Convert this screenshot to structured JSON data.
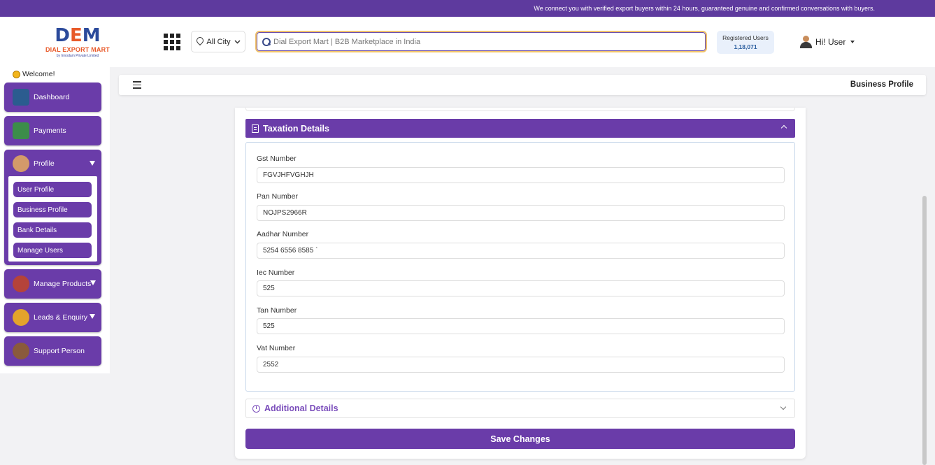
{
  "topbar": {
    "message": "We connect you with verified export buyers within 24 hours, guaranteed genuine and confirmed conversations with buyers."
  },
  "header": {
    "logo_text": "DIAL EXPORT MART",
    "logo_sub": "by Innodam Private Limited",
    "city": "All City",
    "search_placeholder": "Dial Export Mart | B2B Marketplace in India",
    "registered_label": "Registered Users",
    "registered_count": "1,18,071",
    "user_label": "Hi! User"
  },
  "sidebar": {
    "welcome": "Welcome!",
    "items": [
      {
        "label": "Dashboard"
      },
      {
        "label": "Payments"
      },
      {
        "label": "Profile"
      },
      {
        "label": "Manage Products"
      },
      {
        "label": "Leads & Enquiry"
      },
      {
        "label": "Support Person"
      }
    ],
    "profile_sub": [
      {
        "label": "User Profile"
      },
      {
        "label": "Business Profile"
      },
      {
        "label": "Bank Details"
      },
      {
        "label": "Manage Users"
      }
    ]
  },
  "content": {
    "page_title": "Business Profile",
    "section_title": "Taxation Details",
    "fields": [
      {
        "label": "Gst Number",
        "value": "FGVJHFVGHJH"
      },
      {
        "label": "Pan Number",
        "value": "NOJPS2966R"
      },
      {
        "label": "Aadhar Number",
        "value": "5254 6556 8585 `"
      },
      {
        "label": "Iec Number",
        "value": "525"
      },
      {
        "label": "Tan Number",
        "value": "525"
      },
      {
        "label": "Vat Number",
        "value": "2552"
      }
    ],
    "additional_title": "Additional Details",
    "save_label": "Save Changes"
  },
  "colors": {
    "primary": "#6a3ca9",
    "topbar": "#5e3a9e",
    "search_border": "#f0c26a",
    "registered_bg": "#e9f0fb"
  }
}
